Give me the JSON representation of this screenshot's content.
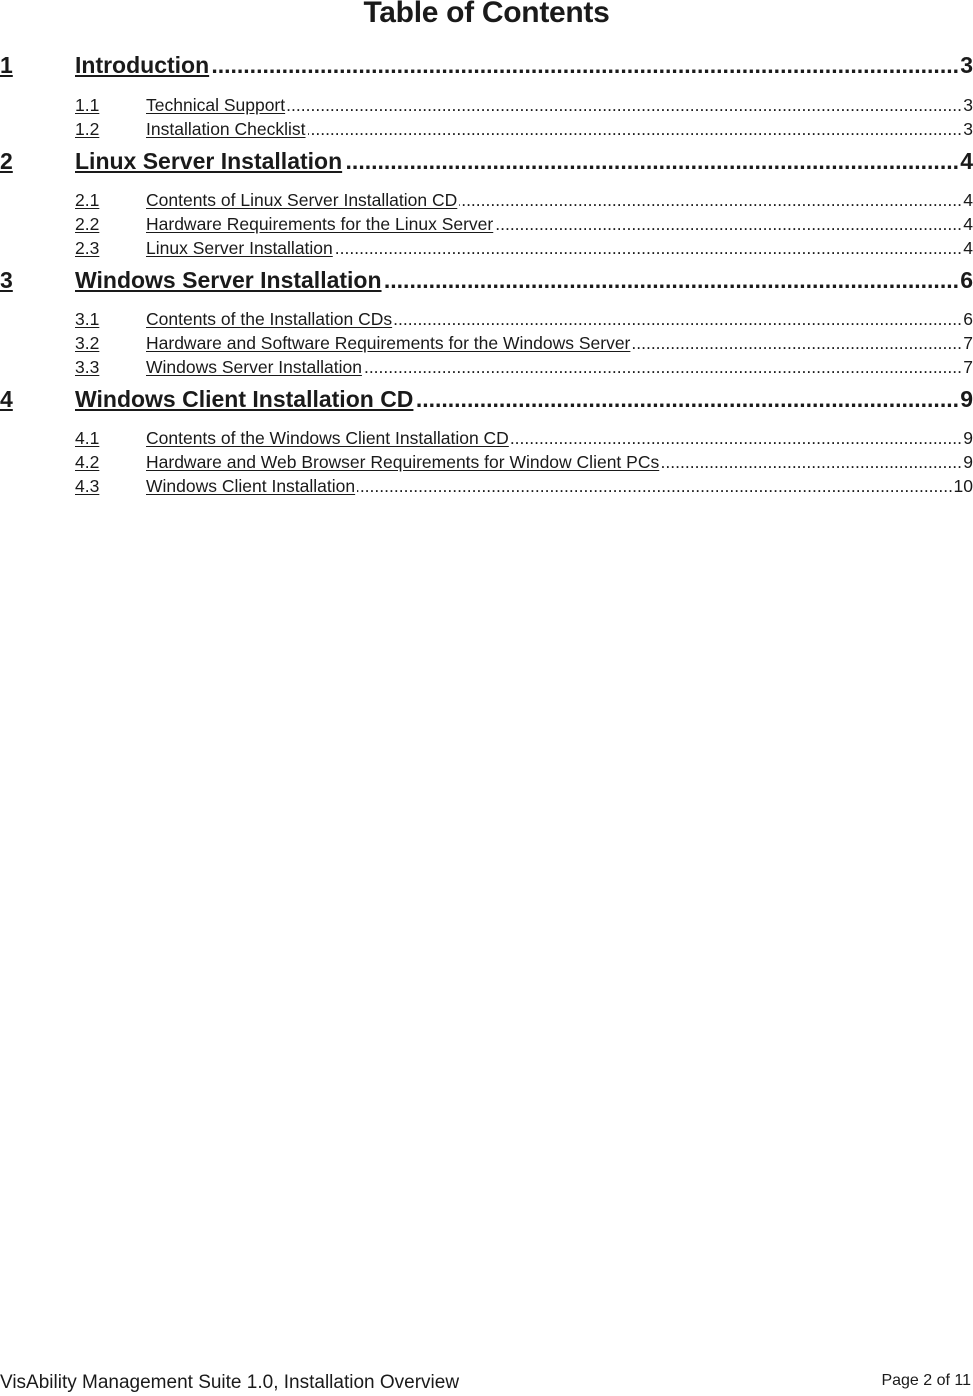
{
  "document": {
    "title": "Table of Contents",
    "footer": {
      "left": "VisAbility Management Suite 1.0, Installation Overview",
      "right": "Page 2 of 11"
    }
  },
  "toc": [
    {
      "level": 1,
      "number": "1",
      "label": "Introduction",
      "page": "3"
    },
    {
      "level": 2,
      "number": "1.1",
      "label": "Technical Support",
      "page": "3"
    },
    {
      "level": 2,
      "number": "1.2",
      "label": "Installation Checklist",
      "page": "3"
    },
    {
      "level": 1,
      "number": "2",
      "label": "Linux Server Installation",
      "page": "4"
    },
    {
      "level": 2,
      "number": "2.1",
      "label": "Contents of Linux Server Installation CD",
      "page": "4"
    },
    {
      "level": 2,
      "number": "2.2",
      "label": "Hardware Requirements for the Linux Server",
      "page": "4"
    },
    {
      "level": 2,
      "number": "2.3",
      "label": "Linux Server Installation",
      "page": "4"
    },
    {
      "level": 1,
      "number": "3",
      "label": "Windows Server Installation",
      "page": "6"
    },
    {
      "level": 2,
      "number": "3.1",
      "label": "Contents of the Installation CDs",
      "page": "6"
    },
    {
      "level": 2,
      "number": "3.2",
      "label": "Hardware and Software Requirements for the Windows Server",
      "page": "7"
    },
    {
      "level": 2,
      "number": "3.3",
      "label": "Windows Server Installation",
      "page": "7"
    },
    {
      "level": 1,
      "number": "4",
      "label": "Windows Client Installation CD",
      "page": "9"
    },
    {
      "level": 2,
      "number": "4.1",
      "label": "Contents of the Windows Client Installation CD",
      "page": "9"
    },
    {
      "level": 2,
      "number": "4.2",
      "label": "Hardware and Web Browser Requirements for Window Client PCs",
      "page": "9"
    },
    {
      "level": 2,
      "number": "4.3",
      "label": "Windows Client Installation",
      "page": "10"
    }
  ]
}
